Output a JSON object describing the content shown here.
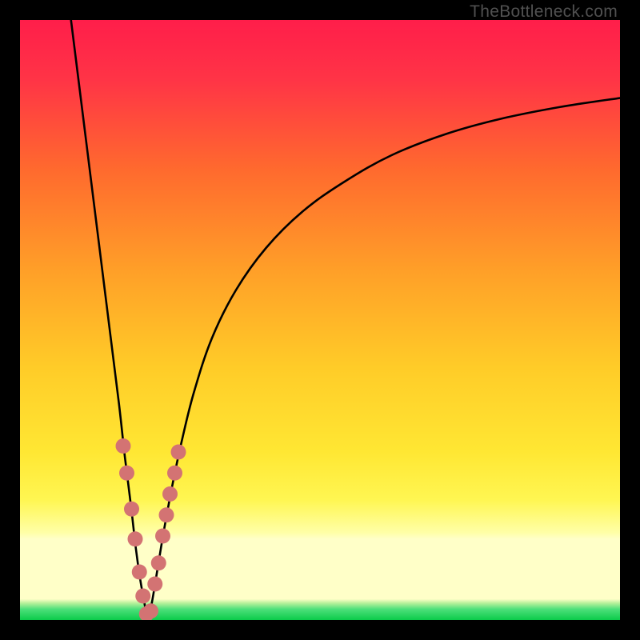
{
  "watermark": "TheBottleneck.com",
  "colors": {
    "top": "#FF2244",
    "upper_mid": "#FF6A2E",
    "mid": "#FFC628",
    "lower_mid": "#FFEE44",
    "pale_band": "#FFFFBB",
    "green": "#18D65C",
    "curve": "#000000",
    "marker_fill": "#D37373",
    "marker_stroke": "#9E4343"
  },
  "chart_data": {
    "type": "line",
    "title": "",
    "xlabel": "",
    "ylabel": "",
    "xlim": [
      0,
      100
    ],
    "ylim": [
      0,
      100
    ],
    "series": [
      {
        "name": "bottleneck-curve-left",
        "x": [
          8.5,
          10,
          12,
          13.5,
          15,
          16.5,
          17.5,
          18.5,
          19.3,
          20,
          20.7,
          21.3
        ],
        "values": [
          100,
          88,
          72,
          60,
          48,
          36,
          27,
          19,
          12,
          7,
          3,
          0
        ]
      },
      {
        "name": "bottleneck-curve-right",
        "x": [
          21.3,
          22,
          23,
          24,
          25.5,
          27,
          29,
          32,
          36,
          41,
          47,
          54,
          62,
          71,
          80,
          90,
          100
        ],
        "values": [
          0,
          3,
          9,
          15,
          23,
          30,
          38,
          47,
          55,
          62,
          68,
          73,
          77.5,
          81,
          83.5,
          85.5,
          87
        ]
      }
    ],
    "markers": {
      "name": "highlighted-points",
      "x": [
        17.2,
        17.8,
        18.6,
        19.2,
        19.9,
        20.5,
        21.1,
        21.8,
        22.5,
        23.1,
        23.8,
        24.4,
        25.0,
        25.8,
        26.4
      ],
      "values": [
        29,
        24.5,
        18.5,
        13.5,
        8,
        4,
        1,
        1.5,
        6,
        9.5,
        14,
        17.5,
        21,
        24.5,
        28
      ]
    }
  }
}
